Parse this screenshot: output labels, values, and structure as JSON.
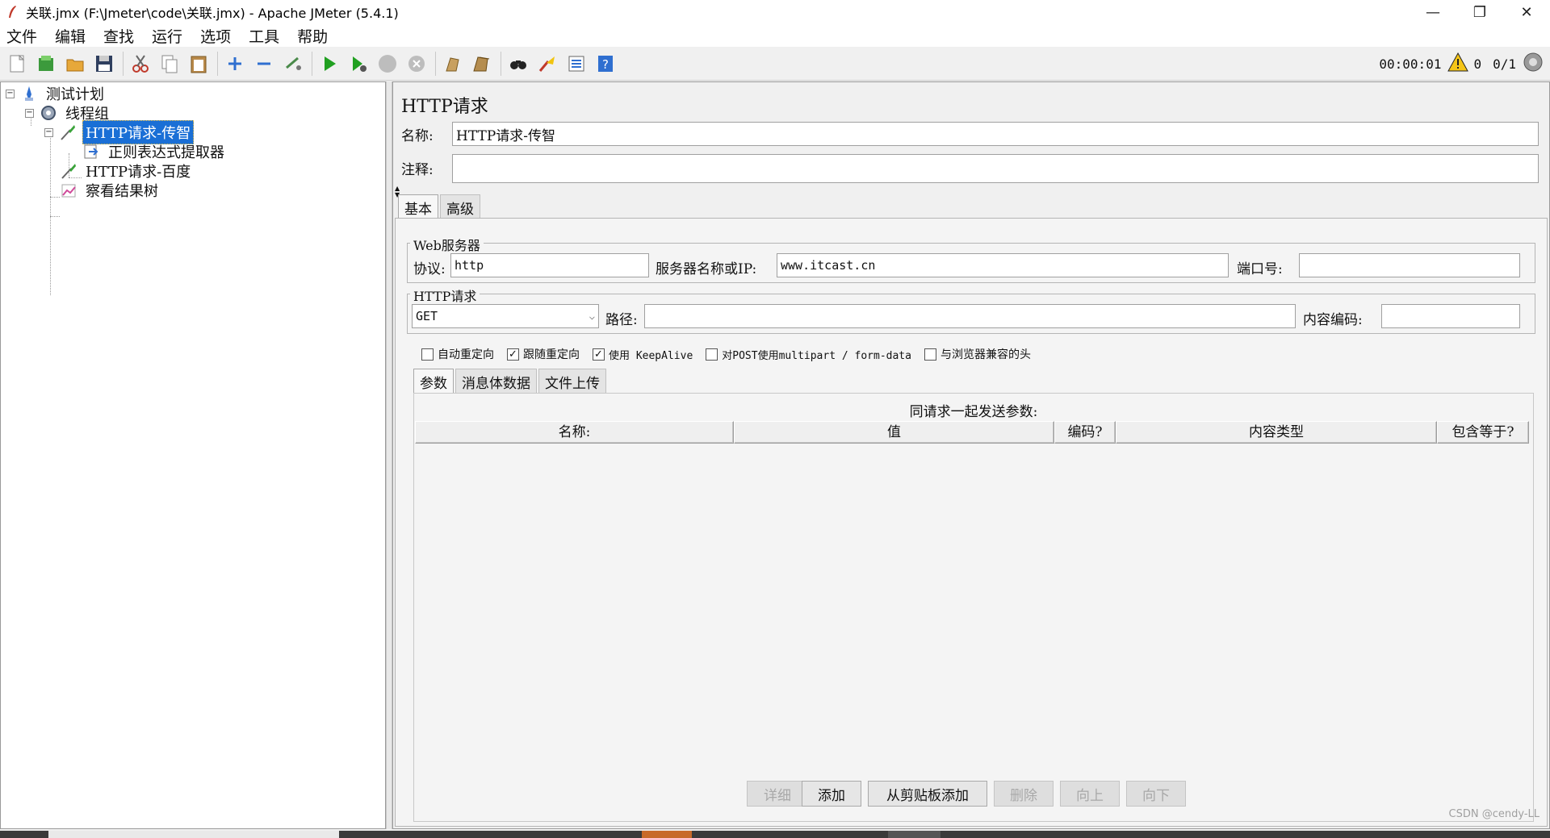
{
  "window": {
    "title": "关联.jmx (F:\\Jmeter\\code\\关联.jmx) - Apache JMeter (5.4.1)",
    "minimize": "—",
    "restore": "❐",
    "close": "✕"
  },
  "menu": [
    "文件",
    "编辑",
    "查找",
    "运行",
    "选项",
    "工具",
    "帮助"
  ],
  "toolbar": {
    "icons": [
      "new-icon",
      "templates-icon",
      "open-icon",
      "save-icon",
      "cut-icon",
      "copy-icon",
      "paste-icon",
      "expand-icon",
      "collapse-icon",
      "toggle-icon",
      "start-icon",
      "start-no-pause-icon",
      "stop-icon",
      "shutdown-icon",
      "clear-icon",
      "clear-all-icon",
      "search-icon",
      "reset-search-icon",
      "function-helper-icon",
      "help-icon"
    ],
    "timer": "00:00:01",
    "warn_count": "0",
    "threads": "0/1"
  },
  "tree": [
    {
      "label": "测试计划",
      "icon": "test-plan-icon",
      "level": 0,
      "expander": "⊟"
    },
    {
      "label": "线程组",
      "icon": "thread-group-icon",
      "level": 1,
      "expander": "⊟"
    },
    {
      "label": "HTTP请求-传智",
      "icon": "http-sampler-icon",
      "level": 2,
      "expander": "⊟",
      "selected": true
    },
    {
      "label": "正则表达式提取器",
      "icon": "extractor-icon",
      "level": 3
    },
    {
      "label": "HTTP请求-百度",
      "icon": "http-sampler-icon",
      "level": 2
    },
    {
      "label": "察看结果树",
      "icon": "listener-icon",
      "level": 2
    }
  ],
  "panel": {
    "title": "HTTP请求",
    "name_label": "名称:",
    "name_value": "HTTP请求-传智",
    "comment_label": "注释:",
    "comment_value": "",
    "tabs": [
      "基本",
      "高级"
    ],
    "web_server": {
      "legend": "Web服务器",
      "protocol_label": "协议:",
      "protocol_value": "http",
      "server_label": "服务器名称或IP:",
      "server_value": "www.itcast.cn",
      "port_label": "端口号:",
      "port_value": ""
    },
    "http_request": {
      "legend": "HTTP请求",
      "method": "GET",
      "path_label": "路径:",
      "path_value": "",
      "encoding_label": "内容编码:",
      "encoding_value": ""
    },
    "options": [
      {
        "label": "自动重定向",
        "checked": false
      },
      {
        "label": "跟随重定向",
        "checked": true
      },
      {
        "label": "使用 KeepAlive",
        "checked": true
      },
      {
        "label": "对POST使用multipart / form-data",
        "checked": false
      },
      {
        "label": "与浏览器兼容的头",
        "checked": false
      }
    ],
    "subtabs": [
      "参数",
      "消息体数据",
      "文件上传"
    ],
    "params_caption": "同请求一起发送参数:",
    "columns": [
      "名称:",
      "值",
      "编码?",
      "内容类型",
      "包含等于?"
    ],
    "buttons": [
      {
        "label": "详细",
        "enabled": false
      },
      {
        "label": "添加",
        "enabled": true
      },
      {
        "label": "从剪贴板添加",
        "enabled": true
      },
      {
        "label": "删除",
        "enabled": false
      },
      {
        "label": "向上",
        "enabled": false
      },
      {
        "label": "向下",
        "enabled": false
      }
    ]
  },
  "watermark": "CSDN @cendy-LL"
}
